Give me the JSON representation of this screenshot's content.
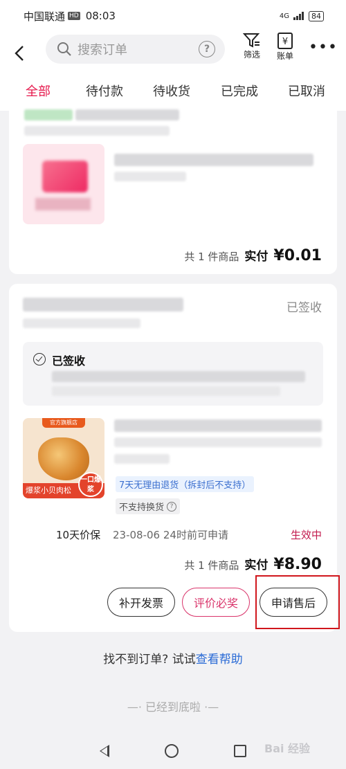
{
  "status_bar": {
    "carrier": "中国联通",
    "hd": "HD",
    "time": "08:03",
    "network": "4G",
    "battery": "84"
  },
  "header": {
    "search_placeholder": "搜索订单",
    "filter_label": "筛选",
    "bill_label": "账单",
    "more": "•••"
  },
  "tabs": [
    {
      "label": "全部",
      "active": true
    },
    {
      "label": "待付款"
    },
    {
      "label": "待收货"
    },
    {
      "label": "已完成"
    },
    {
      "label": "已取消"
    }
  ],
  "order1": {
    "total_count": "共 1 件商品",
    "pay_label": "实付",
    "amount": "¥0.01"
  },
  "order2": {
    "status": "已签收",
    "logistics_title": "已签收",
    "thumb_banner": "官方旗舰店",
    "thumb_foot": "爆浆小贝肉松",
    "thumb_badge": "一口爆浆",
    "chip_return": "7天无理由退货（拆封后不支持）",
    "chip_exchange": "不支持换货",
    "price_protect": "10天价保",
    "price_protect_date": "23-08-06 24时前可申请",
    "price_protect_status": "生效中",
    "total_count": "共 1 件商品",
    "pay_label": "实付",
    "amount": "¥8.90",
    "buttons": {
      "invoice": "补开发票",
      "review": "评价必奖",
      "after_sale": "申请售后"
    }
  },
  "footer": {
    "help_prefix": "找不到订单? 试试",
    "help_link": "查看帮助",
    "bottom": "—· 已经到底啦 ·—"
  },
  "watermark": "Bai 经验"
}
